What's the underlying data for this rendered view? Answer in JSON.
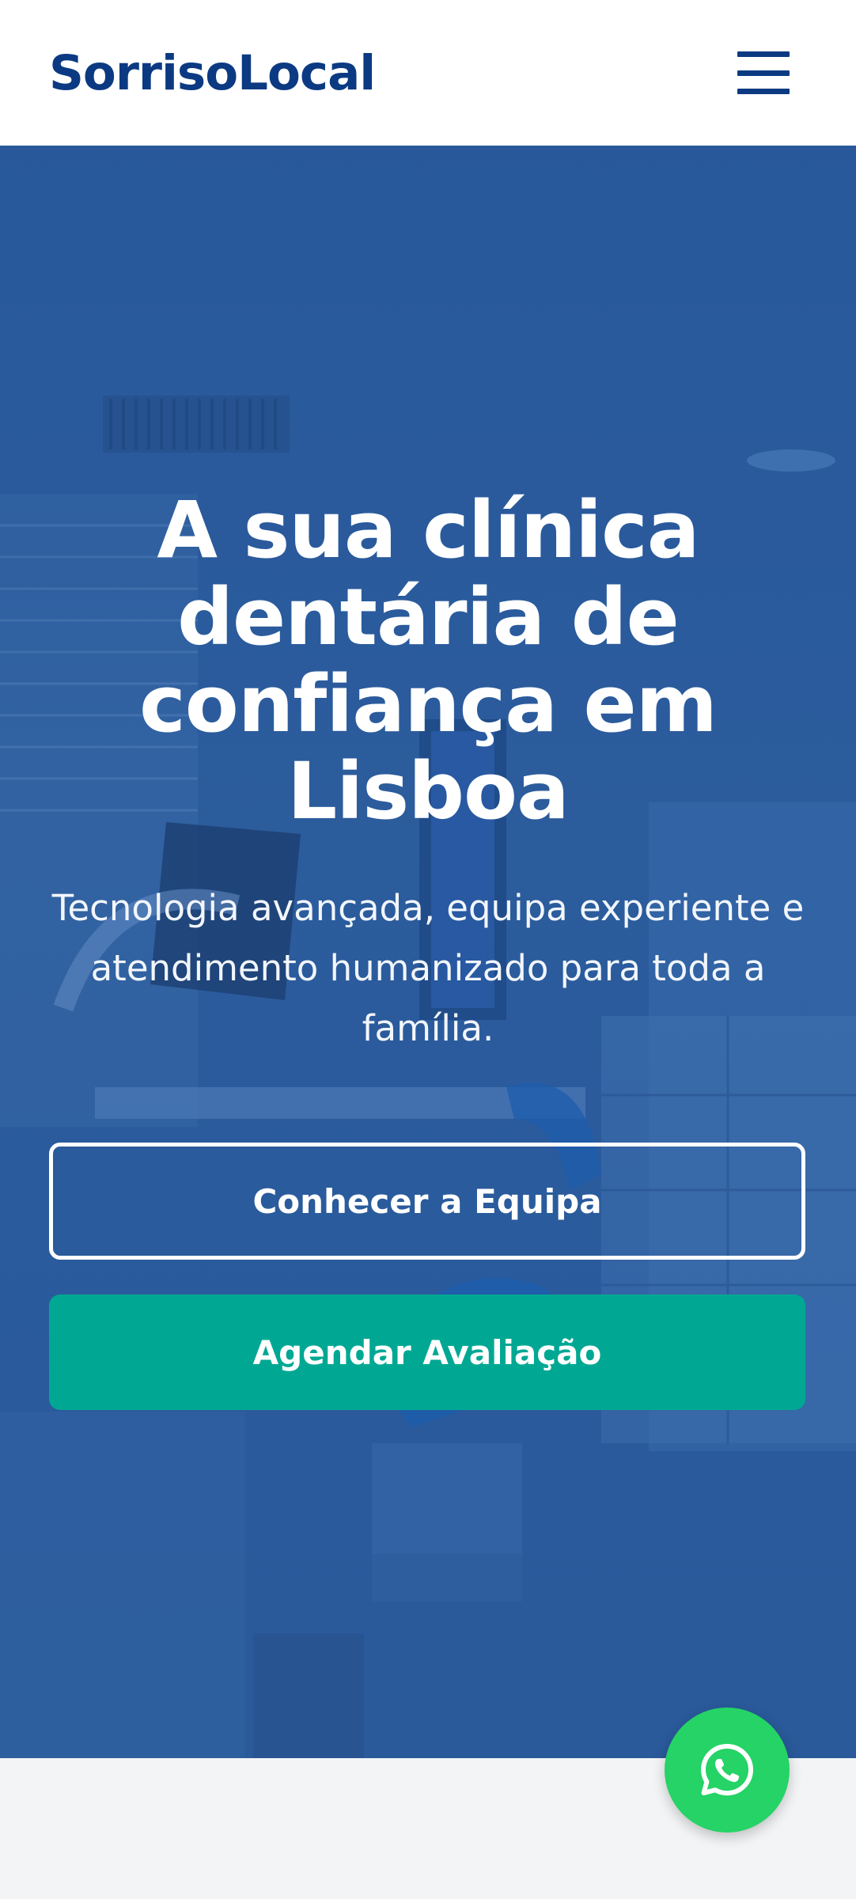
{
  "header": {
    "brand": "SorrisoLocal",
    "menu_icon": "hamburger-menu-icon"
  },
  "hero": {
    "title": "A sua clínica dentária de confiança em Lisboa",
    "subtitle": "Tecnologia avançada, equipa experiente e atendimento humanizado para toda a família.",
    "secondary_button": "Conhecer a Equipa",
    "primary_button": "Agendar Avaliação"
  },
  "fab": {
    "icon": "whatsapp-icon"
  },
  "colors": {
    "brand": "#0b3a82",
    "hero_overlay": "#2c5c9c",
    "primary_button": "#00a893",
    "whatsapp": "#25d366",
    "section_bg": "#f3f4f6"
  }
}
